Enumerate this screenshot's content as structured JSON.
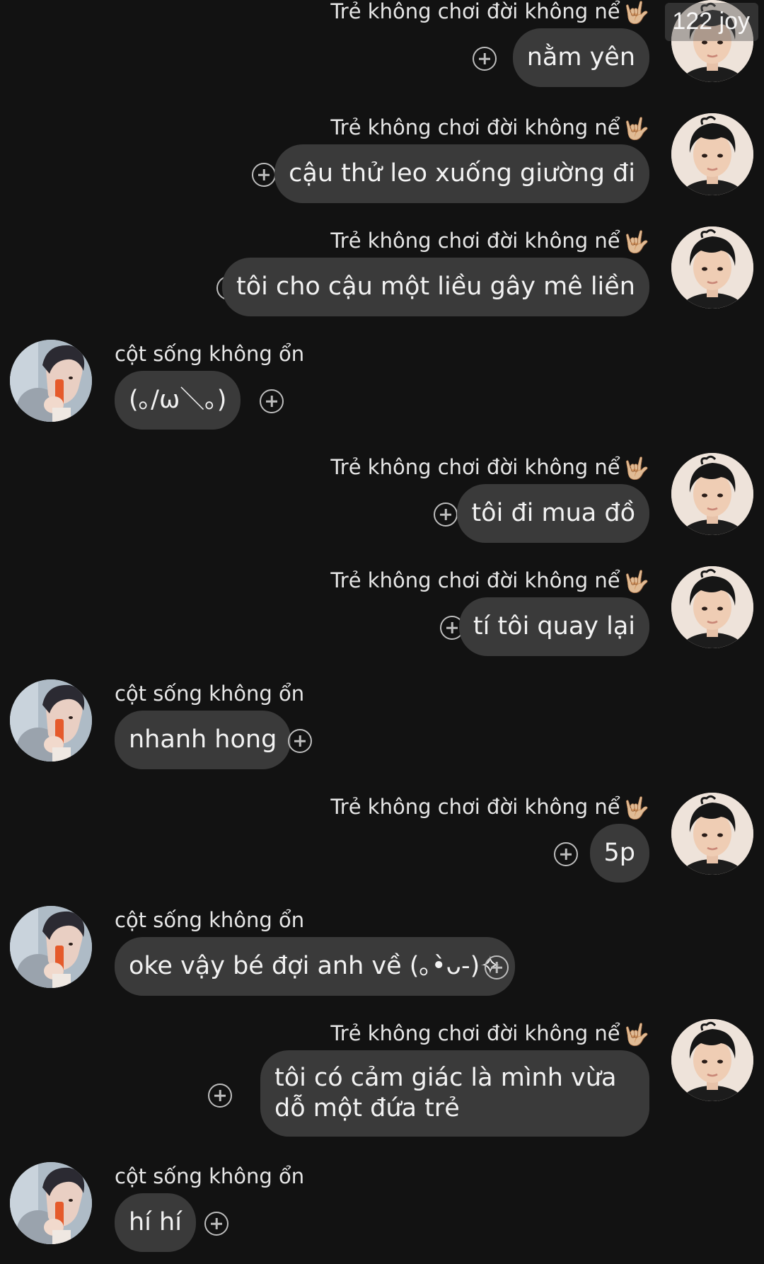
{
  "watermark": "122 joy",
  "contacts": {
    "outgoing_name": "Trẻ không chơi đời không nể",
    "outgoing_name_emoji": "🤟🏼",
    "incoming_name": "cột sống không ổn"
  },
  "messages": [
    {
      "text": "nằm yên"
    },
    {
      "text": "cậu thử leo xuống giường đi"
    },
    {
      "text": "tôi cho cậu một liều gây mê liền"
    },
    {
      "text": "(｡/ω＼｡)"
    },
    {
      "text": "tôi đi mua đồ"
    },
    {
      "text": "tí tôi quay lại"
    },
    {
      "text": "nhanh hong"
    },
    {
      "text": "5p"
    },
    {
      "text": "oke vậy bé đợi anh về (｡•̀ᴗ-)✧"
    },
    {
      "text": "tôi có cảm giác là mình vừa dỗ một đứa trẻ"
    },
    {
      "text": "hí hí"
    }
  ],
  "icons": {
    "react_button": "add-reaction-icon",
    "outgoing_avatar": "boy-with-curly-hair-avatar",
    "incoming_avatar": "boy-with-drink-avatar"
  }
}
